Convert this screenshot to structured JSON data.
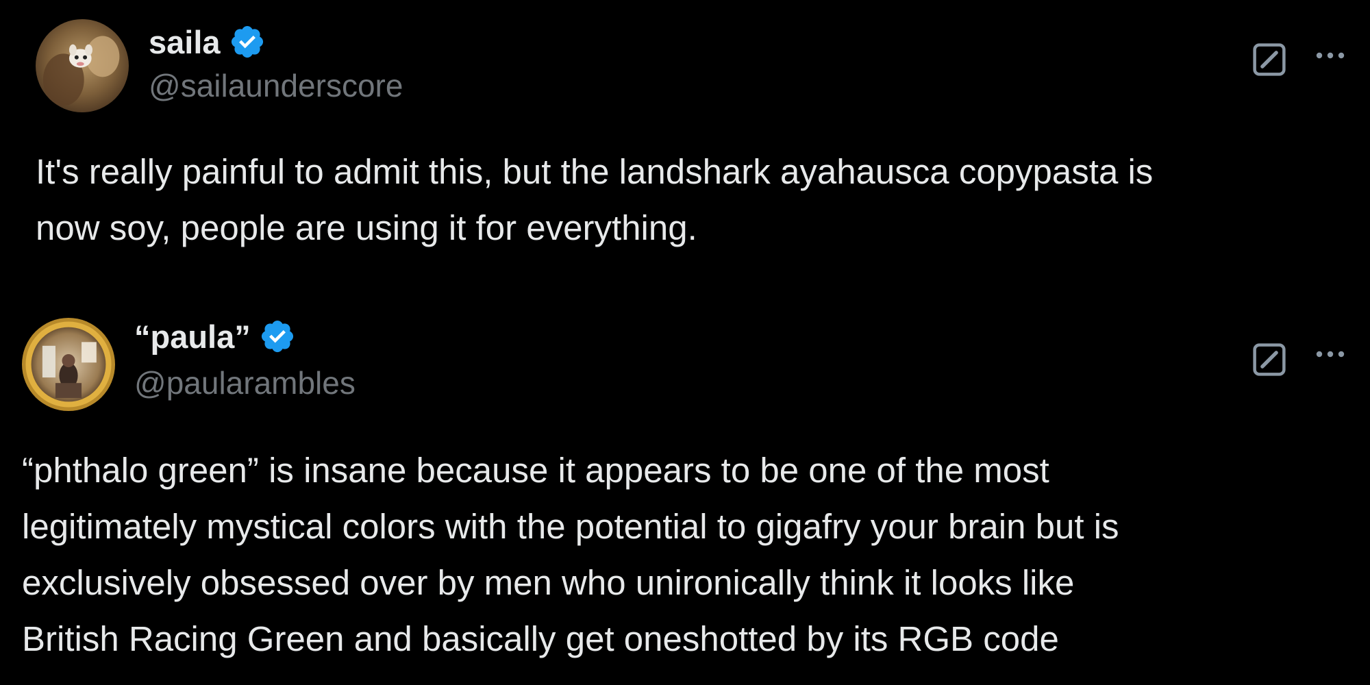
{
  "tweets": [
    {
      "display_name": "saila",
      "handle": "@sailaunderscore",
      "text": "It's really painful to admit this, but the landshark ayahausca copypasta is\nnow soy, people are using it for everything.",
      "verified": true,
      "avatar": "avatar-image",
      "actions": [
        "grok-icon",
        "more-options-icon"
      ]
    },
    {
      "display_name": "“paula”",
      "handle": "@paularambles",
      "text": "“phthalo green” is insane because it appears to be one of the most\nlegitimately mystical colors with the potential to gigafry your brain but is\nexclusively obsessed over by men who unironically think it looks like\nBritish Racing Green and basically get oneshotted by its RGB code",
      "verified": true,
      "avatar": "avatar-image",
      "actions": [
        "grok-icon",
        "more-options-icon"
      ]
    }
  ],
  "colors": {
    "background": "#000000",
    "text": "#e7e9ea",
    "secondary_text": "#71767b",
    "verified_badge": "#1d9bf0"
  }
}
